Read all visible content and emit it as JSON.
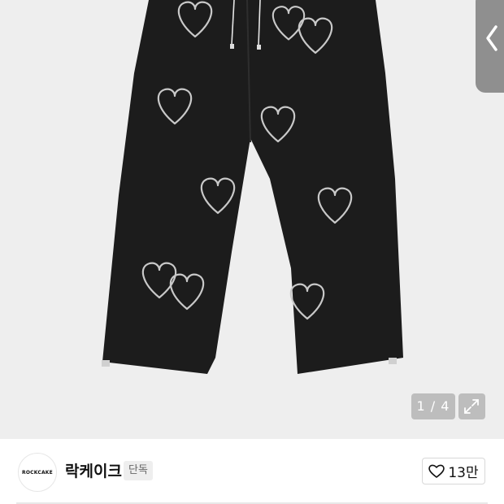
{
  "gallery": {
    "counter": "1 / 4",
    "product_image": "heart-print-wide-pants",
    "icons": {
      "back": "chevron-left-icon",
      "expand": "expand-arrows-icon"
    }
  },
  "shop": {
    "logo_text": "ROCKCAKE",
    "name": "락케이크",
    "badge": "단독",
    "likes": "13만",
    "like_icon": "heart-outline-icon"
  },
  "colors": {
    "background": "#eeeeee",
    "pants": "#1c1c1c",
    "side_tab": "#8f8f8f"
  }
}
